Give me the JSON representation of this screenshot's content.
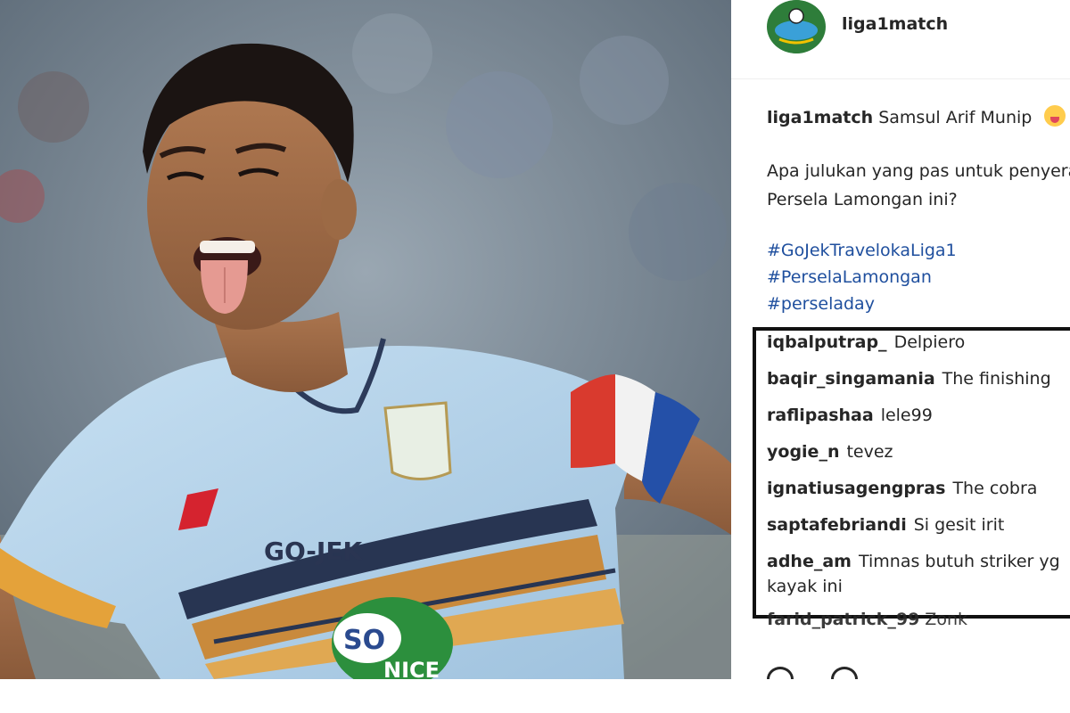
{
  "post": {
    "account": "liga1match",
    "caption_user": "liga1match",
    "caption_text": "Samsul Arif Munip",
    "question_line1": "Apa julukan yang pas untuk penyerang",
    "question_line2": "Persela Lamongan ini?",
    "hashtags": [
      "#GoJekTravelokaLiga1",
      "#PerselaLamongan",
      "#perseladay"
    ]
  },
  "photo": {
    "sponsor_text": "GO-JEK",
    "ball_text": "SO",
    "ball_sub": "NICE"
  },
  "comments": [
    {
      "user": "iqbalputrap_",
      "text": "Delpiero"
    },
    {
      "user": "baqir_singamania",
      "text": "The finishing"
    },
    {
      "user": "raflipashaa",
      "text": "lele99"
    },
    {
      "user": "yogie_n",
      "text": "tevez"
    },
    {
      "user": "ignatiusagengpras",
      "text": "The cobra"
    },
    {
      "user": "saptafebriandi",
      "text": "Si gesit irit"
    },
    {
      "user": "adhe_am",
      "text": "Timnas butuh striker yg kayak ini"
    }
  ],
  "faded_comment": {
    "user": "farid_patrick_99",
    "text": "Zonk"
  },
  "colors": {
    "shirt": "#b5d3ea",
    "armband_red": "#d93a2e",
    "armband_blue": "#2450a8",
    "hashtag": "#1f4f9e",
    "highlight_border": "#111111"
  },
  "icons": [
    "heart-icon",
    "comment-icon"
  ]
}
